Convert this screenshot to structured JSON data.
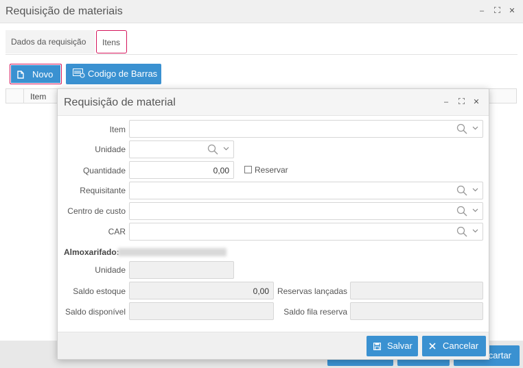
{
  "outer": {
    "title": "Requisição de materiais",
    "controls": {
      "minimize": "–",
      "maximize": "⛶",
      "close": "✕"
    }
  },
  "tabs": [
    {
      "label": "Dados da requisição",
      "active": false
    },
    {
      "label": "Itens",
      "active": true
    }
  ],
  "toolbar": {
    "novo_label": "Novo",
    "barras_label": "Codigo de Barras"
  },
  "grid": {
    "columns": [
      "Item"
    ]
  },
  "footer": {
    "right_button_label": "Descartar",
    "right_button_visible": "rcartar"
  },
  "dialog": {
    "title": "Requisição de material",
    "controls": {
      "minimize": "–",
      "maximize": "⛶",
      "close": "✕"
    },
    "fields": {
      "item": {
        "label": "Item",
        "value": ""
      },
      "unidade": {
        "label": "Unidade",
        "value": ""
      },
      "quantidade": {
        "label": "Quantidade",
        "value": "0,00"
      },
      "reservar": {
        "label": "Reservar",
        "checked": false
      },
      "requisitante": {
        "label": "Requisitante",
        "value": ""
      },
      "centro_custo": {
        "label": "Centro de custo",
        "value": ""
      },
      "car": {
        "label": "CAR",
        "value": ""
      }
    },
    "almoxarifado": {
      "label": "Almoxarifado:",
      "value": "Produto Acabado - MATRIZ"
    },
    "info": {
      "unidade": {
        "label": "Unidade",
        "value": ""
      },
      "saldo_estoque": {
        "label": "Saldo estoque",
        "value": "0,00"
      },
      "reservas_lancadas": {
        "label": "Reservas lançadas",
        "value": ""
      },
      "saldo_disponivel": {
        "label": "Saldo disponível",
        "value": ""
      },
      "saldo_fila_reserva": {
        "label": "Saldo fila reserva",
        "value": ""
      }
    },
    "buttons": {
      "salvar": "Salvar",
      "cancelar": "Cancelar"
    }
  },
  "colors": {
    "primary": "#3a91d1",
    "highlight_border": "#d4145a"
  }
}
